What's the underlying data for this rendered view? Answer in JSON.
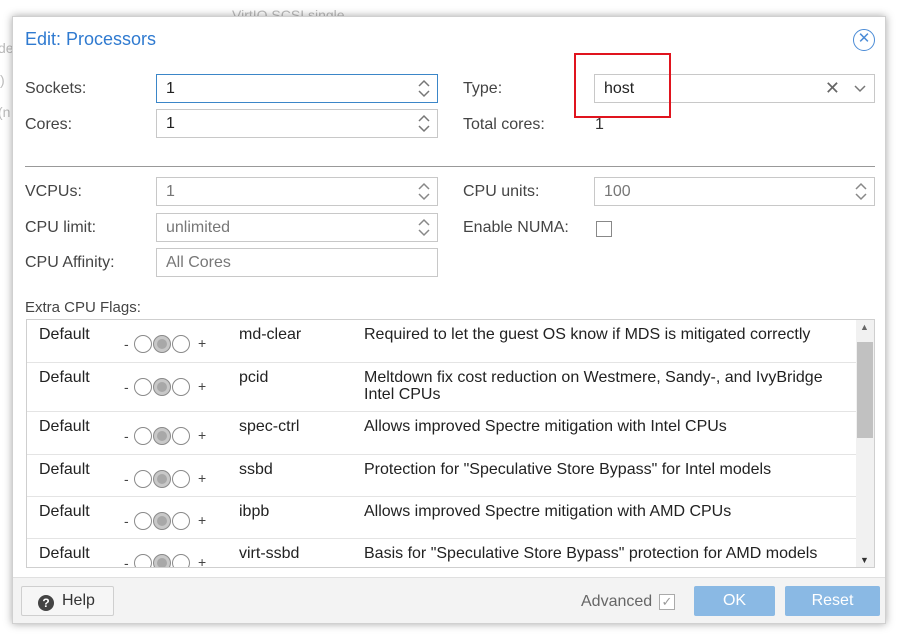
{
  "background": {
    "snippets": [
      "VirtIO SCSI single",
      "de",
      ")",
      "(n"
    ]
  },
  "dialog": {
    "title": "Edit: Processors",
    "close_icon": "close-circle-icon"
  },
  "fields": {
    "sockets": {
      "label": "Sockets:",
      "value": "1"
    },
    "cores": {
      "label": "Cores:",
      "value": "1"
    },
    "type": {
      "label": "Type:",
      "value": "host",
      "clear_glyph": "✕",
      "arrow_glyph": "⌄"
    },
    "total_cores": {
      "label": "Total cores:",
      "value": "1"
    },
    "vcpus": {
      "label": "VCPUs:",
      "value": "1"
    },
    "cpu_units": {
      "label": "CPU units:",
      "value": "100"
    },
    "cpu_limit": {
      "label": "CPU limit:",
      "value": "unlimited"
    },
    "enable_numa": {
      "label": "Enable NUMA:",
      "checked": false
    },
    "cpu_affinity": {
      "label": "CPU Affinity:",
      "placeholder": "All Cores"
    }
  },
  "flags": {
    "label": "Extra CPU Flags:",
    "rows": [
      {
        "state": "Default",
        "name": "md-clear",
        "description": "Required to let the guest OS know if MDS is mitigated correctly"
      },
      {
        "state": "Default",
        "name": "pcid",
        "description": "Meltdown fix cost reduction on Westmere, Sandy-, and IvyBridge Intel CPUs"
      },
      {
        "state": "Default",
        "name": "spec-ctrl",
        "description": "Allows improved Spectre mitigation with Intel CPUs"
      },
      {
        "state": "Default",
        "name": "ssbd",
        "description": "Protection for \"Speculative Store Bypass\" for Intel models"
      },
      {
        "state": "Default",
        "name": "ibpb",
        "description": "Allows improved Spectre mitigation with AMD CPUs"
      },
      {
        "state": "Default",
        "name": "virt-ssbd",
        "description": "Basis for \"Speculative Store Bypass\" protection for AMD models"
      }
    ],
    "toggle": {
      "minus": "-",
      "plus": "+"
    }
  },
  "footer": {
    "help_label": "Help",
    "help_icon_glyph": "?",
    "advanced_label": "Advanced",
    "advanced_checked": true,
    "ok_label": "OK",
    "reset_label": "Reset"
  },
  "colors": {
    "title": "#2f7ad0",
    "highlight_box": "#e0141e",
    "primary_button": "#8ab9e4"
  }
}
